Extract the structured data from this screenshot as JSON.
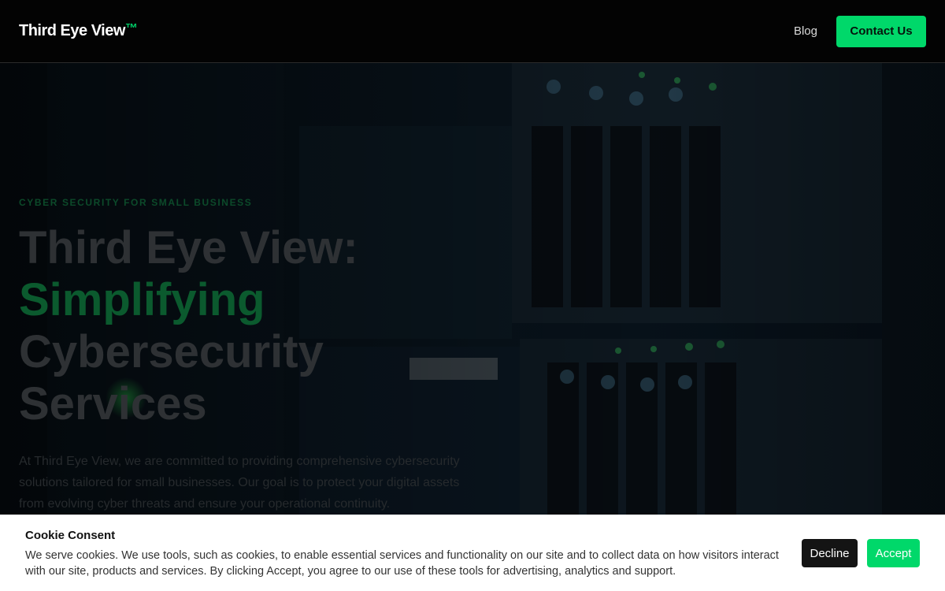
{
  "header": {
    "brand": "Third Eye View",
    "brand_mark": "™",
    "nav_blog": "Blog",
    "contact_button": "Contact Us"
  },
  "hero": {
    "eyebrow": "CYBER SECURITY FOR SMALL BUSINESS",
    "headline_line1": "Third Eye View:",
    "headline_accent": "Simplifying",
    "headline_line3": "Cybersecurity",
    "headline_line4": "Services",
    "description": "At Third Eye View, we are committed to providing comprehensive cybersecurity solutions tailored for small businesses. Our goal is to protect your digital assets from evolving cyber threats and ensure your operational continuity.",
    "background_image": "server-rack-photo"
  },
  "cookie_banner": {
    "title": "Cookie Consent",
    "body": "We serve cookies. We use tools, such as cookies, to enable essential services and functionality on our site and to collect data on how visitors interact with our site, products and services. By clicking Accept, you agree to our use of these tools for advertising, analytics and support.",
    "decline_label": "Decline",
    "accept_label": "Accept"
  },
  "colors": {
    "accent_green": "#00d86a",
    "header_bg": "#030303",
    "banner_bg": "#ffffff"
  }
}
